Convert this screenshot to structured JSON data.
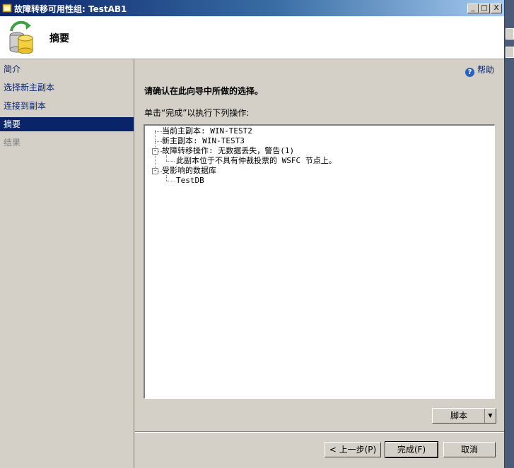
{
  "window": {
    "title": "故障转移可用性组: TestAB1",
    "controls": {
      "minimize": "_",
      "maximize": "□",
      "close": "X"
    }
  },
  "header": {
    "title": "摘要",
    "icon": "database-failover-icon"
  },
  "nav": {
    "items": [
      {
        "label": "简介",
        "state": "link"
      },
      {
        "label": "选择新主副本",
        "state": "link"
      },
      {
        "label": "连接到副本",
        "state": "link"
      },
      {
        "label": "摘要",
        "state": "selected"
      },
      {
        "label": "结果",
        "state": "disabled"
      }
    ]
  },
  "content": {
    "help_label": "帮助",
    "heading": "请确认在此向导中所做的选择。",
    "instruction": "单击“完成”以执行下列操作:",
    "tree": {
      "nodes": [
        {
          "text": "当前主副本: WIN-TEST2"
        },
        {
          "text": "新主副本: WIN-TEST3"
        },
        {
          "text": "故障转移操作: 无数据丢失，警告(1)",
          "expander": "-"
        },
        {
          "text": "此副本位于不具有仲裁投票的 WSFC 节点上。"
        },
        {
          "text": "受影响的数据库",
          "expander": "-"
        },
        {
          "text": "TestDB"
        }
      ]
    }
  },
  "buttons": {
    "script": "脚本",
    "previous": "< 上一步(P)",
    "finish": "完成(F)",
    "cancel": "取消"
  }
}
